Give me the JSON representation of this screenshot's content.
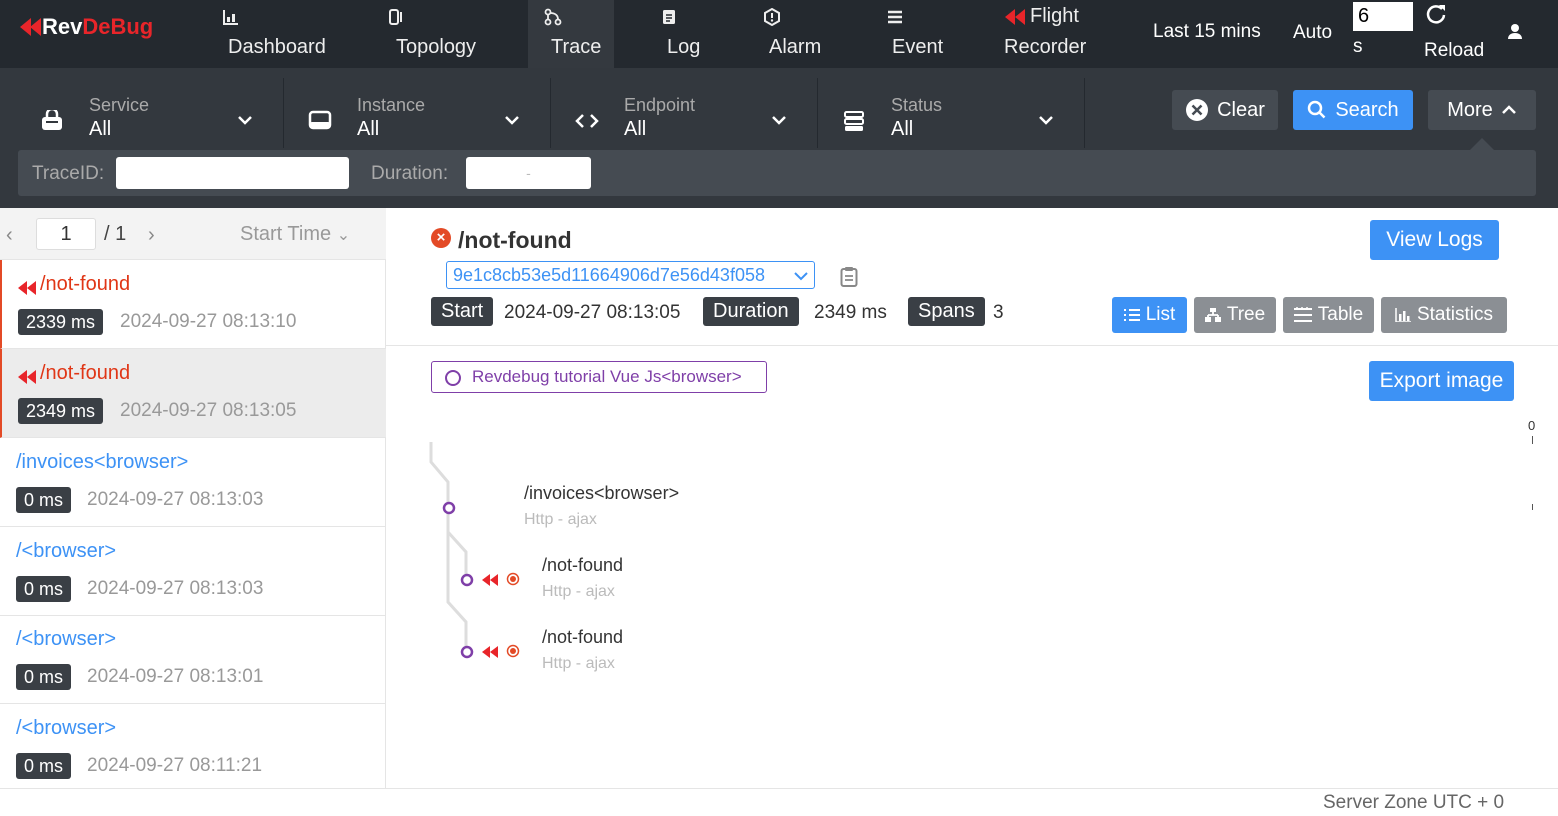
{
  "app": {
    "logo_rev": "Rev",
    "logo_debug": "DeBug",
    "accent": "#e8252a",
    "nav_bg": "#24292f"
  },
  "nav": {
    "items": [
      {
        "label": "Dashboard",
        "icon": "dashboard-icon"
      },
      {
        "label": "Topology",
        "icon": "topology-icon"
      },
      {
        "label": "Trace",
        "icon": "trace-icon",
        "active": true
      },
      {
        "label": "Log",
        "icon": "log-icon"
      },
      {
        "label": "Alarm",
        "icon": "alarm-icon"
      },
      {
        "label": "Event",
        "icon": "event-icon"
      },
      {
        "label_line1": "Flight",
        "label_line2": "Recorder",
        "icon": "flight-recorder-icon"
      }
    ],
    "time_range": "Last 15 mins",
    "auto_label": "Auto",
    "auto_value": "6",
    "auto_unit": "s",
    "reload_label": "Reload"
  },
  "filters": {
    "service": {
      "title": "Service",
      "value": "All"
    },
    "instance": {
      "title": "Instance",
      "value": "All"
    },
    "endpoint": {
      "title": "Endpoint",
      "value": "All"
    },
    "status": {
      "title": "Status",
      "value": "All"
    },
    "clear_label": "Clear",
    "search_label": "Search",
    "more_label": "More",
    "traceid_label": "TraceID:",
    "traceid_value": "",
    "duration_label": "Duration:",
    "duration_separator": "-"
  },
  "list": {
    "page": "1",
    "total": "/ 1",
    "sort_label": "Start Time",
    "items": [
      {
        "name": "/not-found",
        "duration": "2339 ms",
        "time": "2024-09-27 08:13:10",
        "error": true
      },
      {
        "name": "/not-found",
        "duration": "2349 ms",
        "time": "2024-09-27 08:13:05",
        "error": true,
        "selected": true
      },
      {
        "name": "/invoices<browser>",
        "duration": "0 ms",
        "time": "2024-09-27 08:13:03",
        "error": false
      },
      {
        "name": "/<browser>",
        "duration": "0 ms",
        "time": "2024-09-27 08:13:03",
        "error": false
      },
      {
        "name": "/<browser>",
        "duration": "0 ms",
        "time": "2024-09-27 08:13:01",
        "error": false
      },
      {
        "name": "/<browser>",
        "duration": "0 ms",
        "time": "2024-09-27 08:11:21",
        "error": false
      }
    ]
  },
  "detail": {
    "title": "/not-found",
    "trace_id": "9e1c8cb53e5d11664906d7e56d43f058",
    "start_label": "Start",
    "start_value": "2024-09-27 08:13:05",
    "duration_label": "Duration",
    "duration_value": "2349 ms",
    "spans_label": "Spans",
    "spans_value": "3",
    "view_logs_label": "View Logs",
    "views": {
      "list": "List",
      "tree": "Tree",
      "table": "Table",
      "statistics": "Statistics"
    },
    "service_tag": "Revdebug tutorial Vue Js<browser>",
    "export_label": "Export image",
    "axis_zero": "0",
    "spans": [
      {
        "name": "/invoices<browser>",
        "sub": "Http - ajax"
      },
      {
        "name": "/not-found",
        "sub": "Http - ajax"
      },
      {
        "name": "/not-found",
        "sub": "Http - ajax"
      }
    ]
  },
  "footer": {
    "server_zone": "Server Zone UTC + 0"
  }
}
